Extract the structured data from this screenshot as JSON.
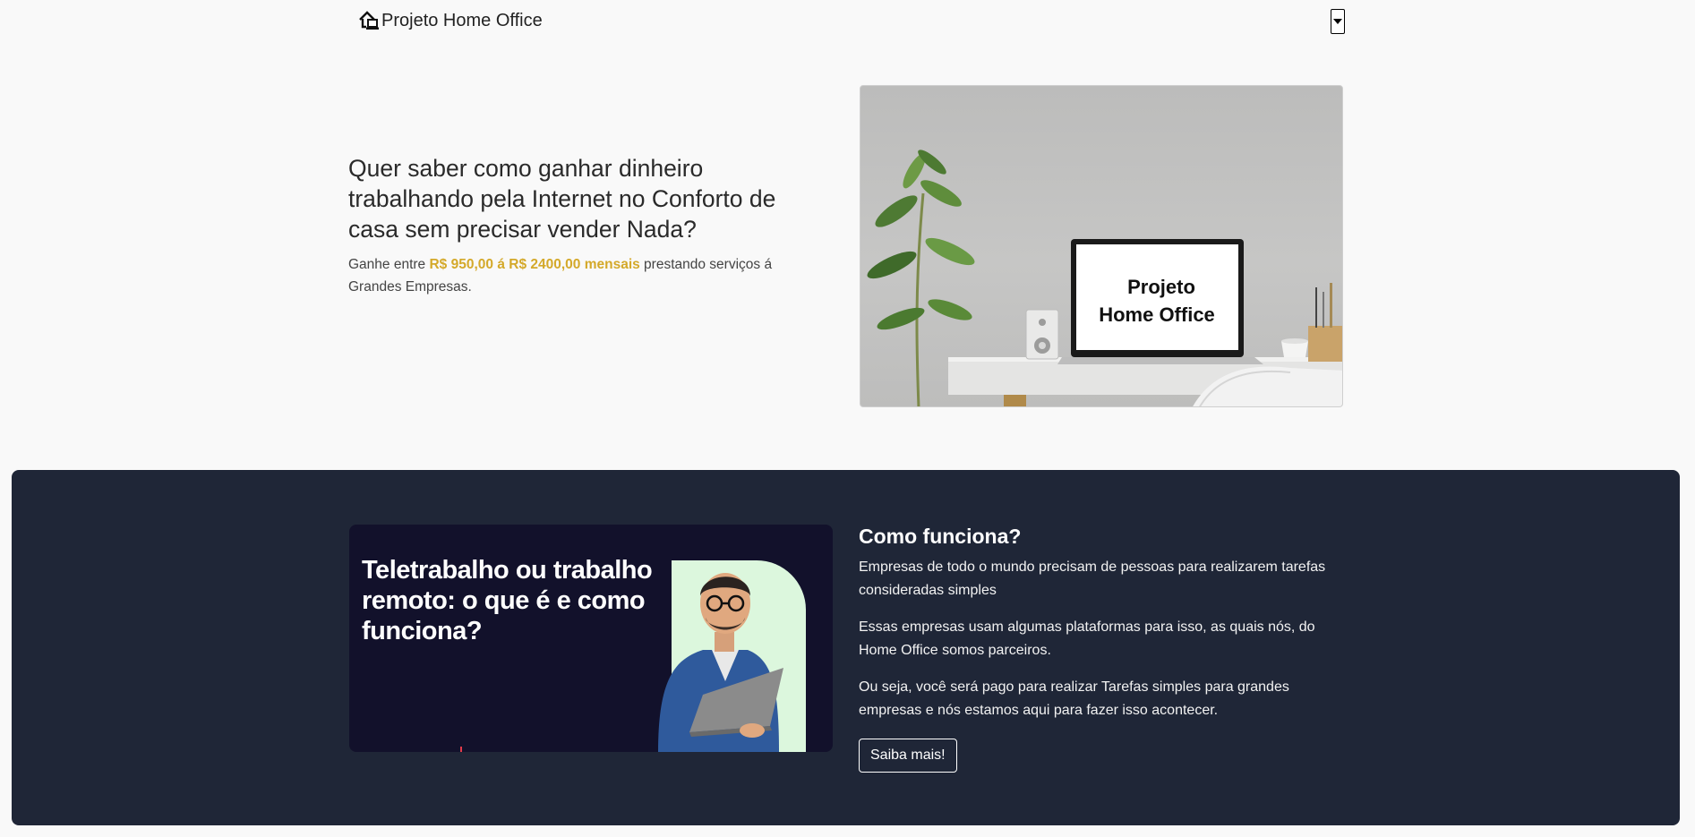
{
  "navbar": {
    "brand_text": "Projeto Home Office",
    "brand_icon": "home-laptop-icon",
    "menu_icon": "caret-down-icon"
  },
  "hero": {
    "title": "Quer saber como ganhar dinheiro trabalhando pela Internet no Conforto de casa sem precisar vender Nada?",
    "sub_prefix": "Ganhe entre ",
    "sub_highlight": "R$ 950,00 á R$ 2400,00 mensais",
    "sub_suffix": " prestando serviços á Grandes Empresas.",
    "image_text_line1": "Projeto",
    "image_text_line2": "Home Office"
  },
  "promo": {
    "title": "Teletrabalho ou trabalho remoto: o que é e como funciona?"
  },
  "info": {
    "heading": "Como funciona?",
    "paragraphs": [
      "Empresas de todo o mundo precisam de pessoas para realizarem tarefas consideradas simples",
      "Essas empresas usam algumas plataformas para isso, as quais nós, do Home Office somos parceiros.",
      "Ou seja, você será pago para realizar Tarefas simples para grandes empresas e nós estamos aqui para fazer isso acontecer."
    ],
    "button_label": "Saiba mais!"
  },
  "colors": {
    "page_bg": "#f9f9f9",
    "dark_section_bg": "#1f2637",
    "highlight": "#d4a92a",
    "promo_bg": "#12112b",
    "promo_panel": "#dcf7dd"
  }
}
